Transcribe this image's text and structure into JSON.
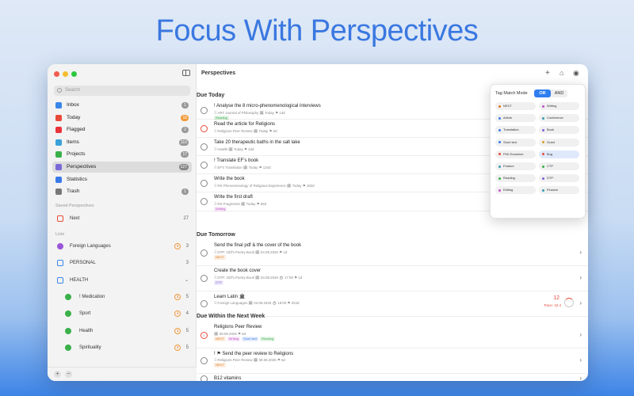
{
  "headline": "Focus With Perspectives",
  "sidebar": {
    "search_placeholder": "Search",
    "nav": [
      {
        "label": "Inbox",
        "count": "1",
        "icon": "inbox-icon",
        "color": "#3a86e8",
        "count_color": "#999999"
      },
      {
        "label": "Today",
        "count": "18",
        "icon": "calendar-today-icon",
        "color": "#e84a3a",
        "count_color": "#f29a3a"
      },
      {
        "label": "Flagged",
        "count": "2",
        "icon": "flag-icon",
        "color": "#e8343a",
        "count_color": "#999999"
      },
      {
        "label": "Items",
        "count": "110",
        "icon": "tray-icon",
        "color": "#3aa0d8",
        "count_color": "#999999"
      },
      {
        "label": "Projects",
        "count": "17",
        "icon": "grid-icon",
        "color": "#3ab04a",
        "count_color": "#999999"
      },
      {
        "label": "Perspectives",
        "count": "127",
        "icon": "layers-icon",
        "color": "#7a6ad8",
        "count_color": "#888888"
      },
      {
        "label": "Statistics",
        "count": "",
        "icon": "chart-icon",
        "color": "#3a7ae8",
        "count_color": "#999999"
      },
      {
        "label": "Trash",
        "count": "1",
        "icon": "trash-icon",
        "color": "#777777",
        "count_color": "#999999"
      }
    ],
    "saved_title": "Saved Perspectives",
    "saved": [
      {
        "label": "Next",
        "count": "27"
      }
    ],
    "lists_title": "Lists",
    "lists": [
      {
        "label": "Foreign Languages",
        "badge": "3",
        "num": "3",
        "color": "#9a55d8"
      },
      {
        "label": "PERSONAL",
        "badge": "",
        "num": "3",
        "color": ""
      },
      {
        "label": "HEALTH",
        "badge": "",
        "num": "⌄",
        "color": ""
      },
      {
        "label": "! Medication",
        "badge": "3",
        "num": "5",
        "color": "#3ab04a"
      },
      {
        "label": "Sport",
        "badge": "4",
        "num": "4",
        "color": "#3ab04a"
      },
      {
        "label": "Health",
        "badge": "3",
        "num": "5",
        "color": "#3ab04a"
      },
      {
        "label": "Spirituality",
        "badge": "3",
        "num": "5",
        "color": "#3ab04a"
      }
    ]
  },
  "main": {
    "title": "Perspectives",
    "sections": [
      {
        "title": "Due Today",
        "tasks": [
          {
            "title": "! Analyse the 8 micro-phenomenological interviews",
            "meta": "⠿ ART Journal of Philosophy  🗓 Today  ⚑ 13d",
            "tags": [
              {
                "t": "Reading",
                "c": "#3ab04a"
              }
            ]
          },
          {
            "title": "Read the article for Religions",
            "meta": "⠿ Religions Peer Review  🗓 Today  ⚑ 6d",
            "tags": []
          },
          {
            "title": "Take 20 therapeutic baths in the salt lake",
            "meta": "⠿ Health  🗓 Today  ⚑ 34d",
            "tags": []
          },
          {
            "title": "! Translate EF's book",
            "meta": "⠿ EF's Translation  🗓 Today  ⚑ 124d",
            "tags": []
          },
          {
            "title": "Write the book",
            "meta": "⠿ RK Phenomenology of Religious Experience  🗓 Today  ⚑ 182d",
            "tags": []
          },
          {
            "title": "Write the first draft",
            "meta": "⠿ RK Fragments  🗓 Today  ⚑ 56d",
            "tags": [
              {
                "t": "Writing",
                "c": "#c050c8"
              }
            ]
          }
        ]
      },
      {
        "title": "Due Tomorrow",
        "tasks": [
          {
            "title": "Send the final pdf & the cover of the book",
            "meta": "⠿ DTP: Gbf's Poetry Book  🗓 04.08.2026  ⚑ 1d",
            "tags": [
              {
                "t": "NEXT",
                "c": "#e07a1a"
              }
            ]
          },
          {
            "title": "Create the book cover",
            "meta": "⠿ DTP: Gbf's Poetry Book  🗓 04.08.2026  ⏱ 17:00  ⚑ 1d",
            "tags": [
              {
                "t": "DTP",
                "c": "#8060d8"
              }
            ]
          },
          {
            "title": "Learn Latin 🏛",
            "meta": "⠿ Foreign Languages  🗓 04.08.2026  ⏱ 18:00  ⚑ 324d",
            "tags": []
          }
        ]
      },
      {
        "title": "Due Within the Next Week",
        "tasks": [
          {
            "title": "Religions Peer Review",
            "meta": "🗓 08.08.2026  ⚑ 5d",
            "tags": [
              {
                "t": "NEXT",
                "c": "#e07a1a"
              },
              {
                "t": "Writing",
                "c": "#c050c8"
              },
              {
                "t": "Short text",
                "c": "#3a7ae8"
              },
              {
                "t": "Reading",
                "c": "#3ab04a"
              }
            ]
          },
          {
            "title": "! ⚑ Send the peer review to Religions",
            "meta": "⠿ Religions Peer Review  🗓 08.08.2026  ⚑ 5d",
            "tags": [
              {
                "t": "NEXT",
                "c": "#e07a1a"
              }
            ]
          },
          {
            "title": "B12 vitamins",
            "meta": "",
            "tags": []
          }
        ]
      }
    ],
    "latin_count": "12",
    "latin_pace": "Pace: 42.4"
  },
  "popover": {
    "label": "Tag Match Mode",
    "or": "OR",
    "and": "AND",
    "chips": [
      {
        "t": "NEXT",
        "c": "#e07a1a"
      },
      {
        "t": "Writing",
        "c": "#c050c8"
      },
      {
        "t": "Article",
        "c": "#3a7ae8"
      },
      {
        "t": "Conference",
        "c": "#3a9ab0"
      },
      {
        "t": "Translation",
        "c": "#3a7ae8"
      },
      {
        "t": "Book",
        "c": "#8060d8"
      },
      {
        "t": "Short text",
        "c": "#3a7ae8"
      },
      {
        "t": "Grant",
        "c": "#d8a030"
      },
      {
        "t": "PhD Examiner",
        "c": "#e84a3a"
      },
      {
        "t": "Bug",
        "c": "#e84a3a"
      },
      {
        "t": "Feature",
        "c": "#3a9ab0"
      },
      {
        "t": "CTP",
        "c": "#3ab04a"
      },
      {
        "t": "Reading",
        "c": "#3ab04a"
      },
      {
        "t": "DTP",
        "c": "#8060d8"
      },
      {
        "t": "Editing",
        "c": "#c050c8"
      },
      {
        "t": "Finance",
        "c": "#3a9ab0"
      }
    ]
  }
}
